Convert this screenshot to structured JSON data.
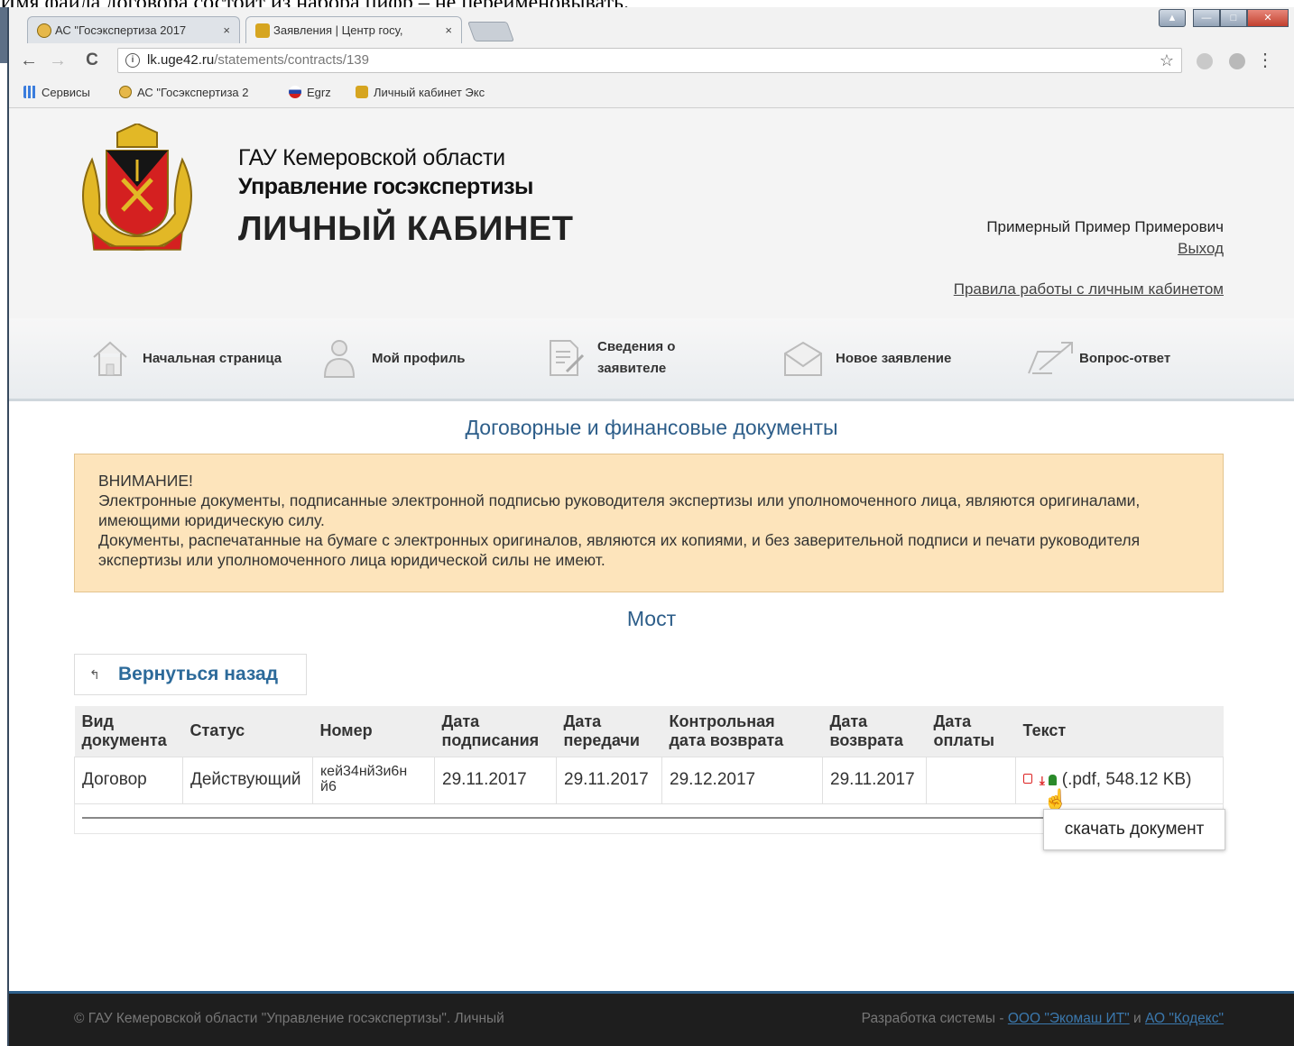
{
  "doc_caption": "Имя файла договора состоит из набора цифр – не переименовывать.",
  "browser": {
    "tabs": [
      {
        "title": "АС \"Госэкспертиза 2017",
        "close": "×"
      },
      {
        "title": "Заявления | Центр госу,",
        "close": "×"
      }
    ],
    "url_host": "lk.uge42.ru",
    "url_path": "/statements/contracts/139",
    "info_glyph": "i",
    "star_glyph": "☆",
    "menu_glyph": "⋮",
    "back_glyph": "←",
    "forward_glyph": "→",
    "reload_glyph": "C",
    "bookmarks": [
      {
        "label": "Сервисы",
        "icon": "apps-grid-icon"
      },
      {
        "label": "АС \"Госэкспертиза 2",
        "icon": "site-favicon"
      },
      {
        "label": "Egrz",
        "icon": "flag-icon"
      },
      {
        "label": "Личный кабинет Экс",
        "icon": "coat-of-arms-icon"
      }
    ]
  },
  "header": {
    "org_line1": "ГАУ Кемеровской области",
    "org_line2": "Управление госэкспертизы",
    "org_line3": "ЛИЧНЫЙ КАБИНЕТ",
    "user_name": "Примерный Пример Примерович",
    "logout": "Выход",
    "rules_link": "Правила работы с личным кабинетом"
  },
  "nav": {
    "home": "Начальная страница",
    "profile": "Мой профиль",
    "applicant_l1": "Сведения о",
    "applicant_l2": "заявителе",
    "new_statement": "Новое заявление",
    "faq": "Вопрос-ответ"
  },
  "content": {
    "title": "Договорные и финансовые документы",
    "warning_title": "ВНИМАНИЕ!",
    "warning_p1": "Электронные документы, подписанные электронной подписью руководителя экспертизы или уполномоченного лица, являются оригиналами, имеющими юридическую силу.",
    "warning_p2": "Документы, распечатанные на бумаге с электронных оригиналов, являются их копиями, и без заверительной подписи и печати руководителя экспертизы или уполномоченного лица юридической силы не имеют.",
    "object_name": "Мост",
    "back_label": "Вернуться назад",
    "back_glyph": "↰"
  },
  "table": {
    "headers": {
      "doc_type_l1": "Вид",
      "doc_type_l2": "документа",
      "status": "Статус",
      "number": "Номер",
      "sign_l1": "Дата",
      "sign_l2": "подписания",
      "transfer_l1": "Дата",
      "transfer_l2": "передачи",
      "control_l1": "Контрольная",
      "control_l2": "дата возврата",
      "return_l1": "Дата",
      "return_l2": "возврата",
      "pay_l1": "Дата",
      "pay_l2": "оплаты",
      "text": "Текст"
    },
    "row": {
      "doc_type": "Договор",
      "status": "Действующий",
      "number_l1": "кей34нй3и6н",
      "number_l2": "й6",
      "sign_date": "29.11.2017",
      "transfer_date": "29.11.2017",
      "control_date": "29.12.2017",
      "return_date": "29.11.2017",
      "pay_date": "",
      "download_glyph": "⤓",
      "hand_glyph": "☝",
      "file_info": "(.pdf, 548.12 KB)"
    },
    "tooltip": "скачать документ"
  },
  "footer": {
    "copyright": "© ГАУ Кемеровской области \"Управление госэкспертизы\". Личный",
    "dev_prefix": "Разработка системы - ",
    "dev1": "ООО \"Экомаш ИТ\"",
    "and": " и ",
    "dev2": "АО \"Кодекс\""
  }
}
